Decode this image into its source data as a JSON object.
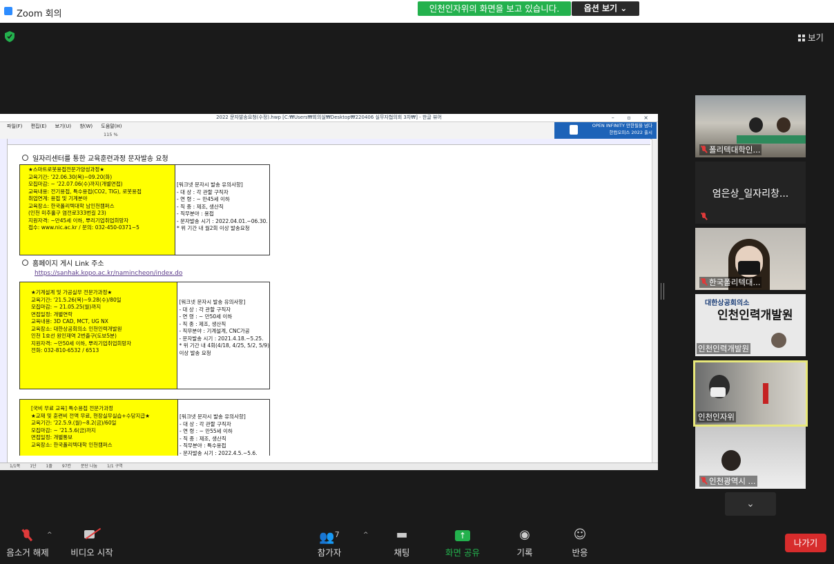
{
  "window": {
    "title": "Zoom 회의"
  },
  "banner": {
    "text": "인천인자위의 화면을 보고 있습니다.",
    "options_label": "옵션 보기 ⌄"
  },
  "view_button": {
    "label": "보기"
  },
  "shared_window": {
    "title": "2022 문자발송요청(수정).hwp [C:₩Users₩회의실₩Desktop₩220406 실무자협의회 3차₩] - 한글 뷰어",
    "menu": [
      "파일(F)",
      "편집(E)",
      "보기(U)",
      "창(W)",
      "도움말(H)"
    ],
    "zoom": "115 %",
    "hancom_banner": "한컴오피스 2022 출시",
    "hancom_small": "OPEN INFINITY 만한필을 넘다",
    "status": [
      "1/1쪽",
      "1단",
      "1줄",
      "97칸",
      "문단 나눔",
      "1/1 구역"
    ]
  },
  "document": {
    "heading1": "일자리센터를 통한 교육훈련과정 문자발송 요청",
    "heading2": "홈페이지 게시 Link 주소",
    "link": "https://sanhak.kopo.ac.kr/namincheon/index.do",
    "box1": {
      "left": [
        "★스마트로봇용접전문가양성과정★",
        "",
        "교육기간: '22.06.30(목)~09.20(화)",
        "모집마감: ~ '22.07.06(수)까지(개별면접)",
        "교육내용: 전기용접, 특수용접(CO2, TIG), 로봇용접",
        "취업연계: 용접 및 기계분야",
        "교육장소: 한국폴리텍대학 남인천캠퍼스",
        "(인천 미추홀구 염전로333번길 23)",
        "지원자격: ~만45세 이하, 뿌리기업취업희망자",
        "접수: www.nic.ac.kr / 문의: 032-450-0371~5"
      ],
      "right": [
        "[워크넷 문자시 발송 유의사항]",
        "- 대 상 : 각 관할 구직자",
        "- 연 령 : ~ 만45세 이하",
        "- 직 종 : 제조, 생산직",
        "- 직무분야 : 용접",
        "- 문자발송 시기 : 2022.04.01.~06.30.",
        " * 위 기간 내 월2회 이상 발송요청"
      ]
    },
    "box2": {
      "left": [
        "★기계설계 및 가공실무 전문가과정★",
        "",
        "교육기간: '21.5.26(목)~9.28(수)/80일",
        "모집마감: ~ 21.05.25(월)까지",
        "면접일정: 개별연락",
        "교육내용: 3D CAD, MCT, UG NX",
        "교육장소: 대한상공회의소 인천인력개발원",
        "            인천 1호선 원인재역 2번출구(도보5분)",
        "지원자격: ~만50세 이하, 뿌리기업취업희망자",
        "전화: 032-810-6532 / 6513"
      ],
      "right": [
        "[워크넷 문자시 발송 유의사항]",
        "- 대 상 : 각 관할 구직자",
        "- 연 령 : ~ 만50세 이하",
        "- 직 종 : 제조, 생산직",
        "- 직무분야 : 기계설계, CNC가공",
        "- 문자발송 시기 : 2021.4.18.~5.25.",
        " * 위 기간 내 4회(4/18, 4/25, 5/2, 5/9)",
        "    이상 발송 요청"
      ]
    },
    "box3": {
      "left": [
        "[국비 무료 교육] 특수용접 전문가과정",
        "★교재 및 훈련비 전액 무료, 현장실무실습+수당지급★",
        "",
        "교육기간: '22.5.9.(월)~8.2(금)/60일",
        "모집마감: ~ '21.5.6(금)까지",
        "면접일정: 개별통보",
        "교육장소: 한국폴리텍대학 인천캠퍼스"
      ],
      "right": [
        "[워크넷 문자시 발송 유의사항]",
        "- 대 상 : 각 관할 구직자",
        "- 연 령 : ~ 만55세 이하",
        "- 직 종 : 제조, 생산직",
        "- 직무분야 : 특수용접",
        "- 문자발송 시기 : 2022.4.5.~5.6."
      ]
    }
  },
  "participants": [
    {
      "name": "폴리텍대학인...",
      "muted": true
    },
    {
      "name": "엄은상_일자리창...",
      "muted": true,
      "video": false
    },
    {
      "name": "한국폴리텍대...",
      "muted": true
    },
    {
      "name": "인천인력개발원",
      "muted": false,
      "sign_org": "대한상공회의소",
      "sign_title": "인천인력개발원"
    },
    {
      "name": "인천인자위",
      "muted": false,
      "active": true
    },
    {
      "name": "인천광역시 ...",
      "muted": true
    }
  ],
  "toolbar": {
    "mute": "음소거 해제",
    "video": "비디오 시작",
    "participants": "참가자",
    "participants_count": "7",
    "chat": "채팅",
    "share": "화면 공유",
    "record": "기록",
    "reactions": "반응",
    "leave": "나가기"
  },
  "colors": {
    "accent_green": "#23b14d",
    "leave_red": "#d72c2c",
    "active_border": "#e8e87a",
    "highlight_yellow": "#ffff00"
  }
}
